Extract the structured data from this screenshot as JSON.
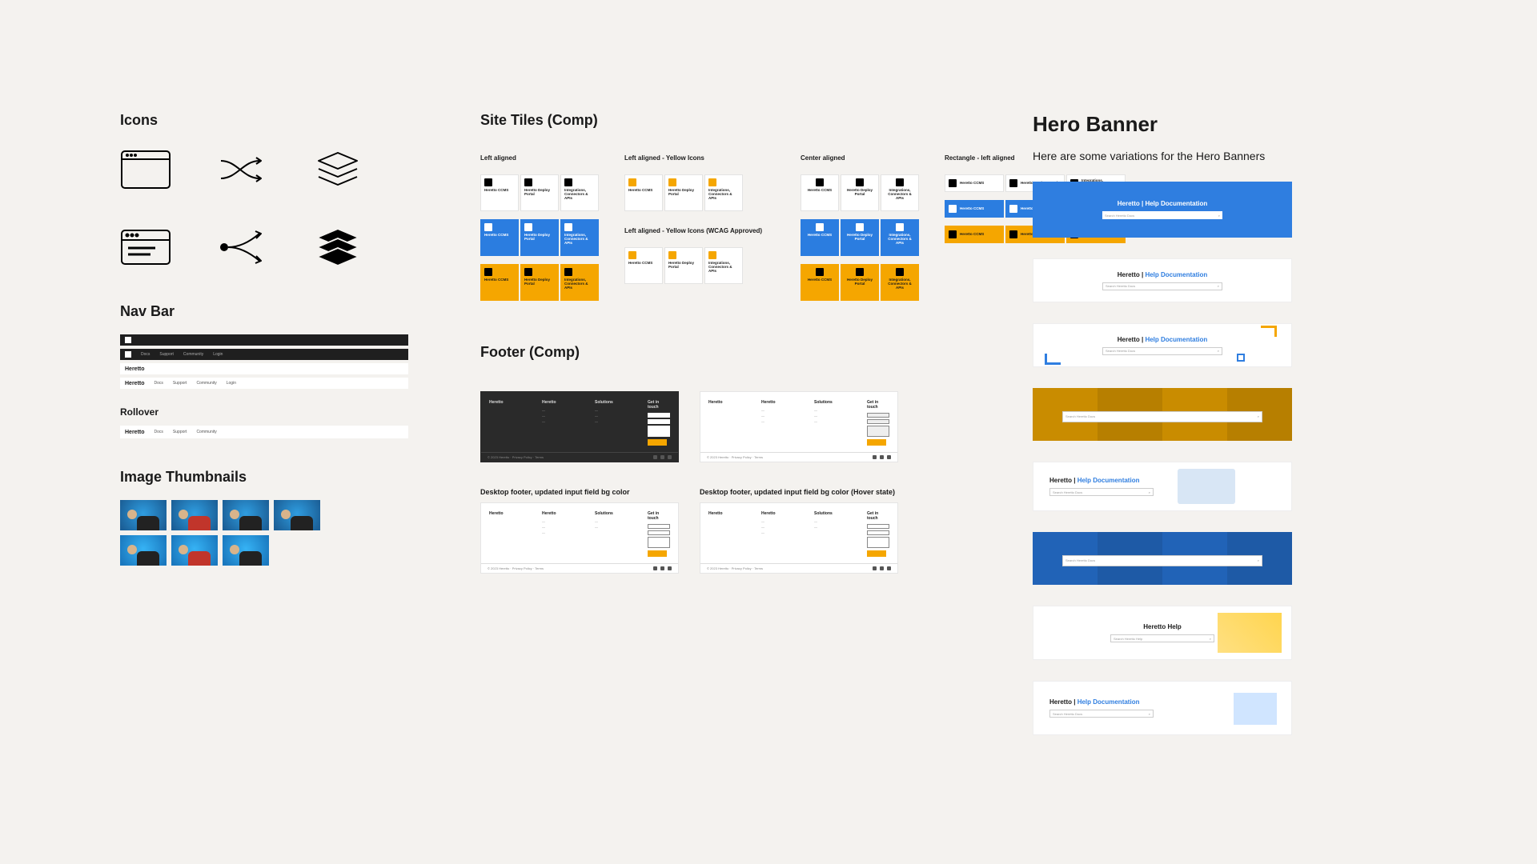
{
  "sections": {
    "icons": "Icons",
    "navbar": "Nav Bar",
    "rollover": "Rollover",
    "thumbnails": "Image Thumbnails",
    "site_tiles": "Site Tiles (Comp)",
    "footer": "Footer (Comp)",
    "hero": "Hero Banner"
  },
  "hero_lede": "Here are some variations for the Hero Banners",
  "tile_labels": {
    "left": "Left aligned",
    "left_yellow": "Left aligned - Yellow Icons",
    "center": "Center aligned",
    "rect": "Rectangle - left aligned",
    "left_yellow_wcag": "Left aligned - Yellow Icons (WCAG Approved)"
  },
  "tile_content": {
    "t1": {
      "title": "Heretto CCMS",
      "sub": ""
    },
    "t2": {
      "title": "Heretto Deploy Portal",
      "sub": ""
    },
    "t3": {
      "title": "Integrations, Connectors & APIs",
      "sub": ""
    }
  },
  "footer_labels": {
    "a": "Desktop footer, updated input field bg color",
    "b": "Desktop footer, updated input field bg color (Hover state)"
  },
  "footer_cols": {
    "brand": "Heretto",
    "c1": "Heretto",
    "c2": "Solutions",
    "c3": "Get in touch"
  },
  "footer_legal": "© 2023 Heretto · Privacy Policy · Terms",
  "nav_items": [
    "Docs",
    "Support",
    "Community",
    "Login"
  ],
  "nav_brand": "Heretto",
  "hero": {
    "title_prefix": "Heretto | ",
    "title_link": "Help Documentation",
    "help_title": "Heretto Help",
    "search_placeholder": "Search Heretto Docs",
    "search_placeholder2": "Search Heretto Help"
  }
}
